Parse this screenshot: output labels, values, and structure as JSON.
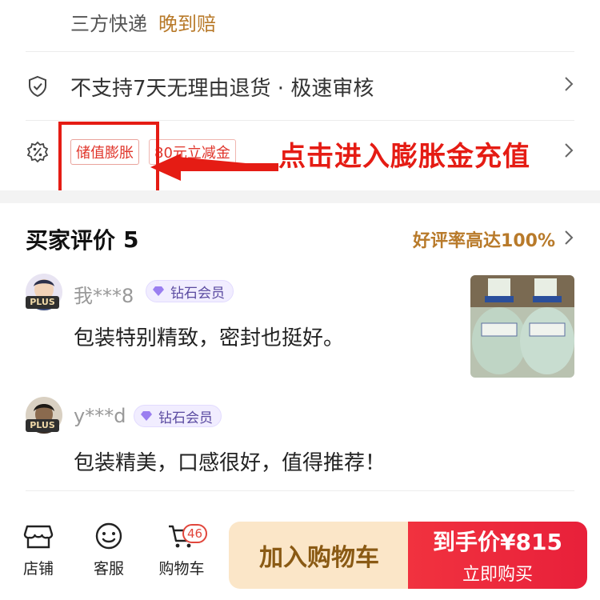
{
  "shipping": {
    "label": "三方快递",
    "highlight": "晚到赔"
  },
  "return_policy": {
    "text": "不支持7天无理由退货 · 极速审核",
    "icon": "shield-check-icon"
  },
  "coupon": {
    "icon": "percent-badge-icon",
    "tag1": "储值膨胀",
    "tag2": "80元立减金"
  },
  "annotation": {
    "text": "点击进入膨胀金充值",
    "color": "#e51c14"
  },
  "reviews": {
    "title": "买家评价",
    "count": "5",
    "rate": "好评率高达100%",
    "items": [
      {
        "user": "我***8",
        "badge": "PLUS",
        "member": "钻石会员",
        "text": "包装特别精致，密封也挺好。"
      },
      {
        "user": "y***d",
        "badge": "PLUS",
        "member": "钻石会员",
        "text": "包装精美，口感很好，值得推荐！"
      }
    ]
  },
  "bottom_nav": {
    "store": "店铺",
    "service": "客服",
    "cart": "购物车",
    "cart_count": "46"
  },
  "actions": {
    "add_to_cart": "加入购物车",
    "price_label": "到手价¥815",
    "buy_now": "立即购买"
  },
  "colors": {
    "accent_gold": "#b87a2a",
    "red": "#e8203a",
    "member_purple": "#5a4aa0"
  }
}
